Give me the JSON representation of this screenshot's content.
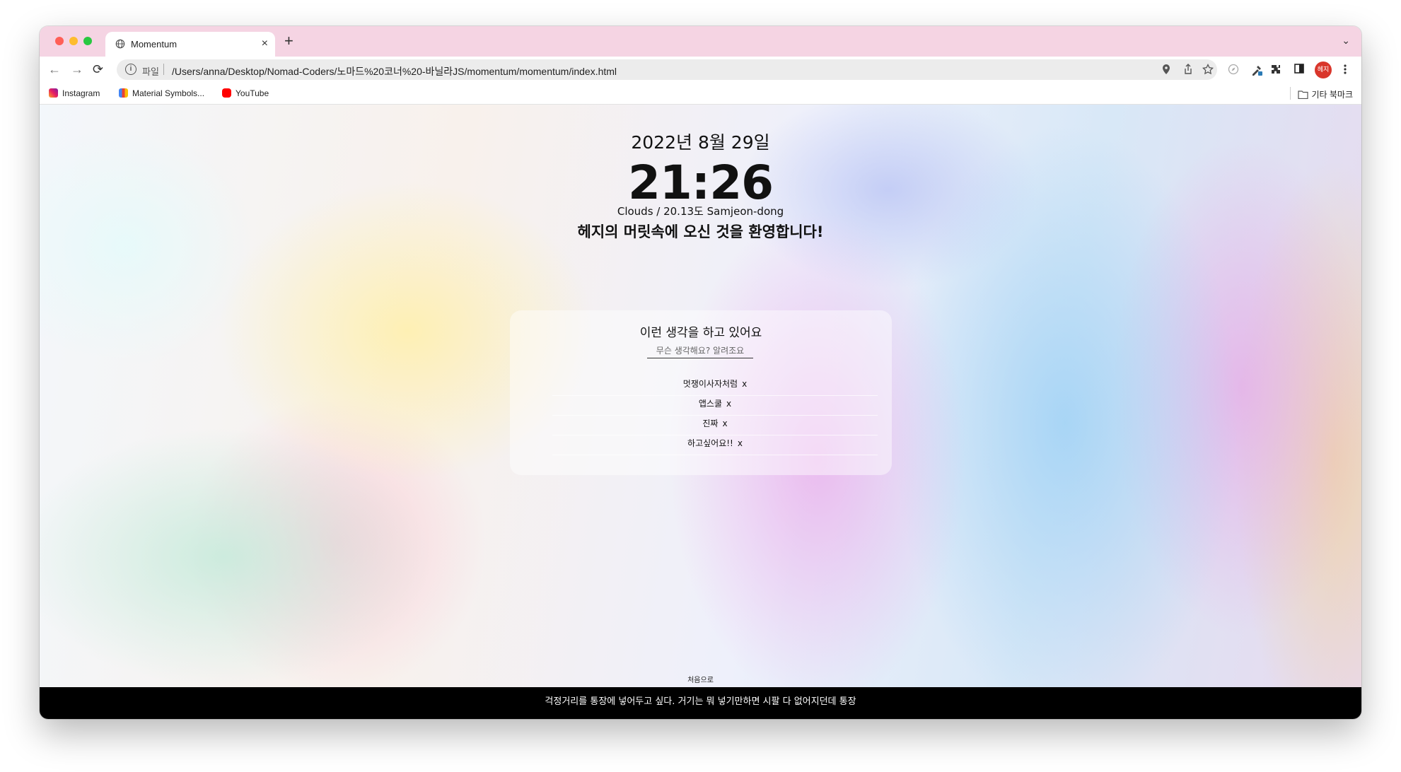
{
  "browser": {
    "tab": {
      "title": "Momentum",
      "close_glyph": "×"
    },
    "new_tab_glyph": "+",
    "tab_menu_glyph": "⌄",
    "nav": {
      "back": "←",
      "forward": "→",
      "reload": "⟳"
    },
    "omnibox": {
      "info_glyph": "i",
      "scheme_label": "파일",
      "url": "/Users/anna/Desktop/Nomad-Coders/노마드%20코너%20-바닐라JS/momentum/momentum/index.html"
    },
    "avatar_label": "헤지"
  },
  "bookmarks": {
    "items": [
      {
        "label": "Instagram",
        "icon": "instagram-icon"
      },
      {
        "label": "Material Symbols...",
        "icon": "material-symbols-icon"
      },
      {
        "label": "YouTube",
        "icon": "youtube-icon"
      }
    ],
    "other": "기타 북마크"
  },
  "page": {
    "date": "2022년 8월 29일",
    "clock": "21:26",
    "weather": "Clouds / 20.13도 Samjeon-dong",
    "greeting": "헤지의 머릿속에 오신 것을 환영합니다!",
    "todo": {
      "title": "이런 생각을 하고 있어요",
      "placeholder": "무슨 생각해요? 알려조요",
      "delete_label": "x",
      "items": [
        "멋쟁이사자처럼",
        "앱스쿨",
        "진짜",
        "하고싶어요!!"
      ]
    },
    "restart_label": "처음으로",
    "footer_quote": "걱정거리를 통장에 넣어두고 싶다. 거기는 뭐 넣기만하면 시팔 다 없어지던데 통장"
  },
  "colors": {
    "tabstrip": "#f5d4e3",
    "footer_bg": "#000000",
    "avatar_bg": "#d9362b"
  }
}
